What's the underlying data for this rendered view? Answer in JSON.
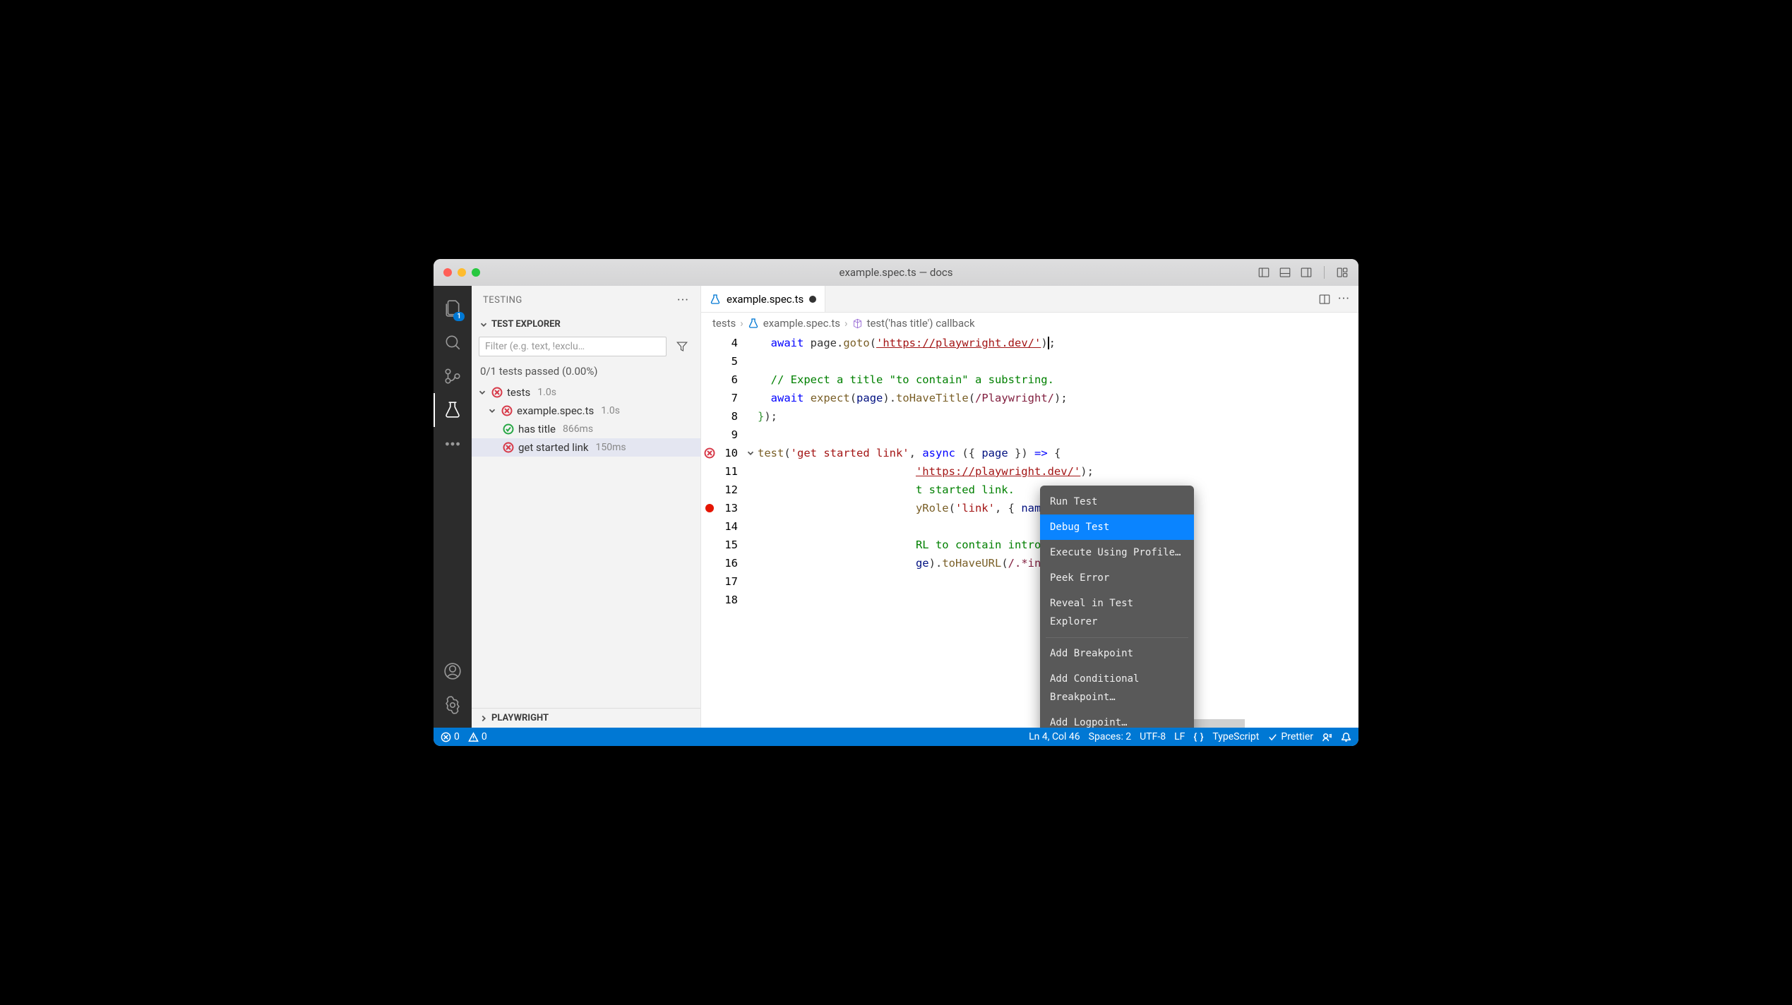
{
  "titlebar": {
    "title": "example.spec.ts — docs"
  },
  "activity": {
    "explorer_badge": "1"
  },
  "sidebar": {
    "title": "TESTING",
    "section_title": "TEST EXPLORER",
    "filter_placeholder": "Filter (e.g. text, !exclu…",
    "test_summary": "0/1 tests passed (0.00%)",
    "tree": {
      "root_label": "tests",
      "root_time": "1.0s",
      "file_label": "example.spec.ts",
      "file_time": "1.0s",
      "tests": [
        {
          "label": "has title",
          "time": "866ms",
          "status": "pass"
        },
        {
          "label": "get started link",
          "time": "150ms",
          "status": "fail"
        }
      ]
    },
    "playwright_title": "PLAYWRIGHT"
  },
  "editor": {
    "tab_label": "example.spec.ts",
    "breadcrumb": {
      "folder": "tests",
      "file": "example.spec.ts",
      "symbol": "test('has title') callback"
    },
    "lines_start": 4,
    "lines_end": 18,
    "code": {
      "l4_await": "await",
      "l4_goto": "page.goto(",
      "l4_url": "'https://playwright.dev/'",
      "l4_end": ");",
      "l6_comment": "// Expect a title \"to contain\" a substring.",
      "l7": "await expect(page).toHaveTitle(/Playwright/);",
      "l8": "});",
      "l10_test": "test",
      "l10_name": "'get started link'",
      "l10_async": "async",
      "l10_params": " ({ page }) => {",
      "l11_url_frag": "'https://playwright.dev/'",
      "l11_end": ");",
      "l12_frag": "t started link.",
      "l13_frag": "yRole('link', { name: 'start' }).click();",
      "l15_frag": "RL to contain intro.",
      "l16_frag": "ge).toHaveURL(/.*intro/);"
    }
  },
  "context_menu": {
    "items": [
      "Run Test",
      "Debug Test",
      "Execute Using Profile…",
      "Peek Error",
      "Reveal in Test Explorer",
      "Add Breakpoint",
      "Add Conditional Breakpoint…",
      "Add Logpoint…"
    ],
    "active_index": 1,
    "separator_after": [
      4
    ]
  },
  "status_bar": {
    "errors": "0",
    "warnings": "0",
    "lncol": "Ln 4, Col 46",
    "spaces": "Spaces: 2",
    "encoding": "UTF-8",
    "eol": "LF",
    "lang": "TypeScript",
    "prettier": "Prettier"
  }
}
